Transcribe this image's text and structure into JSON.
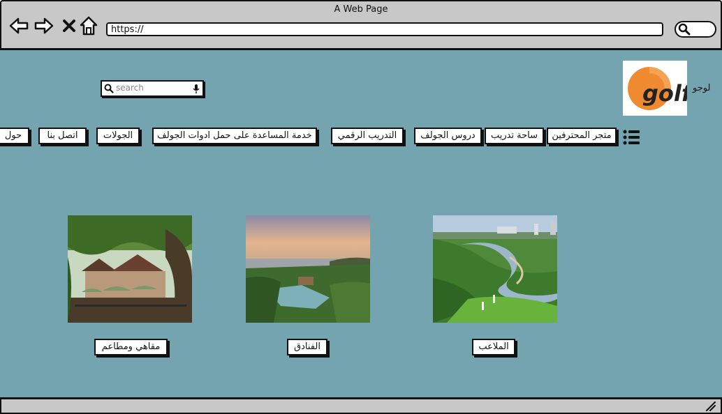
{
  "window": {
    "title": "A Web Page"
  },
  "browser": {
    "address": "https://",
    "back_icon": "arrow-left-icon",
    "forward_icon": "arrow-right-icon",
    "close_icon": "x-icon",
    "home_icon": "home-icon",
    "search_icon": "search-icon"
  },
  "header": {
    "logo_label": "لوجو",
    "logo_text": "golf",
    "logo_colors": {
      "circle": "#f08a30",
      "text": "#222222"
    },
    "search_placeholder": "search"
  },
  "nav": {
    "menu_icon": "hamburger-icon",
    "items": [
      {
        "label": "متجر المحترفين"
      },
      {
        "label": "ساحة تدريب"
      },
      {
        "label": "دروس الجولف"
      },
      {
        "label": "التدريب الرقمي"
      },
      {
        "label": "خدمة المساعدة على حمل ادوات الجولف"
      },
      {
        "label": "الجولات"
      },
      {
        "label": "اتصل بنا"
      },
      {
        "label": "حول"
      }
    ]
  },
  "cards": [
    {
      "label": "الملاعب",
      "image": "golf-course-photo"
    },
    {
      "label": "الفنادق",
      "image": "resort-photo"
    },
    {
      "label": "مقاهي ومطاعم",
      "image": "cafe-photo"
    }
  ],
  "colors": {
    "page_bg": "#73a4b0",
    "chrome_bg": "#c8c8c8"
  }
}
